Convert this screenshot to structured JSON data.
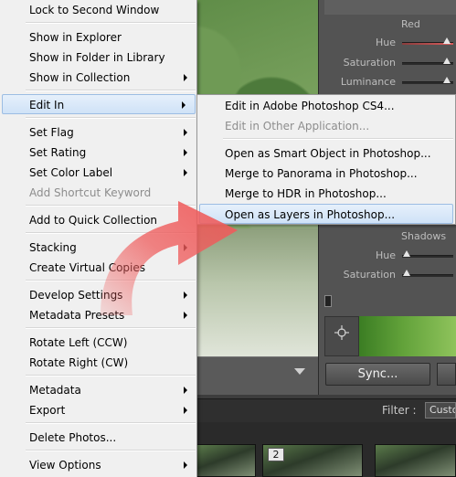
{
  "menu": {
    "items": [
      {
        "label": "Lock to Second Window",
        "disabled": false,
        "submenu": false
      },
      {
        "label": "Show in Explorer",
        "disabled": false,
        "submenu": false
      },
      {
        "label": "Show in Folder in Library",
        "disabled": false,
        "submenu": false
      },
      {
        "label": "Show in Collection",
        "disabled": false,
        "submenu": true
      },
      {
        "label": "Edit In",
        "disabled": false,
        "submenu": true
      },
      {
        "label": "Set Flag",
        "disabled": false,
        "submenu": true
      },
      {
        "label": "Set Rating",
        "disabled": false,
        "submenu": true
      },
      {
        "label": "Set Color Label",
        "disabled": false,
        "submenu": true
      },
      {
        "label": "Add Shortcut Keyword",
        "disabled": true,
        "submenu": false
      },
      {
        "label": "Add to Quick Collection",
        "disabled": false,
        "submenu": false
      },
      {
        "label": "Stacking",
        "disabled": false,
        "submenu": true
      },
      {
        "label": "Create Virtual Copies",
        "disabled": false,
        "submenu": false
      },
      {
        "label": "Develop Settings",
        "disabled": false,
        "submenu": true
      },
      {
        "label": "Metadata Presets",
        "disabled": false,
        "submenu": true
      },
      {
        "label": "Rotate Left (CCW)",
        "disabled": false,
        "submenu": false
      },
      {
        "label": "Rotate Right (CW)",
        "disabled": false,
        "submenu": false
      },
      {
        "label": "Metadata",
        "disabled": false,
        "submenu": true
      },
      {
        "label": "Export",
        "disabled": false,
        "submenu": true
      },
      {
        "label": "Delete Photos...",
        "disabled": false,
        "submenu": false
      },
      {
        "label": "View Options",
        "disabled": false,
        "submenu": true
      }
    ]
  },
  "submenu": {
    "items": [
      {
        "label": "Edit in Adobe Photoshop CS4...",
        "disabled": false
      },
      {
        "label": "Edit in Other Application...",
        "disabled": true
      },
      {
        "label": "Open as Smart Object in Photoshop...",
        "disabled": false
      },
      {
        "label": "Merge to Panorama in Photoshop...",
        "disabled": false
      },
      {
        "label": "Merge to HDR in Photoshop...",
        "disabled": false
      },
      {
        "label": "Open as Layers in Photoshop...",
        "disabled": false
      }
    ]
  },
  "right_panel": {
    "red_heading": "Red",
    "hue_label": "Hue",
    "saturation_label": "Saturation",
    "luminance_label": "Luminance",
    "shadows_heading": "Shadows",
    "shadows_hue_label": "Hue",
    "shadows_saturation_label": "Saturation",
    "sync_label": "Sync..."
  },
  "filter": {
    "label": "Filter :",
    "value": "Custo"
  },
  "filmstrip": {
    "badge": "2"
  },
  "colors": {
    "menu_bg": "#f0f0f0",
    "highlight_border": "#9cbde3",
    "annotation_arrow": "#ef5b5b",
    "panel_bg": "#535353"
  }
}
